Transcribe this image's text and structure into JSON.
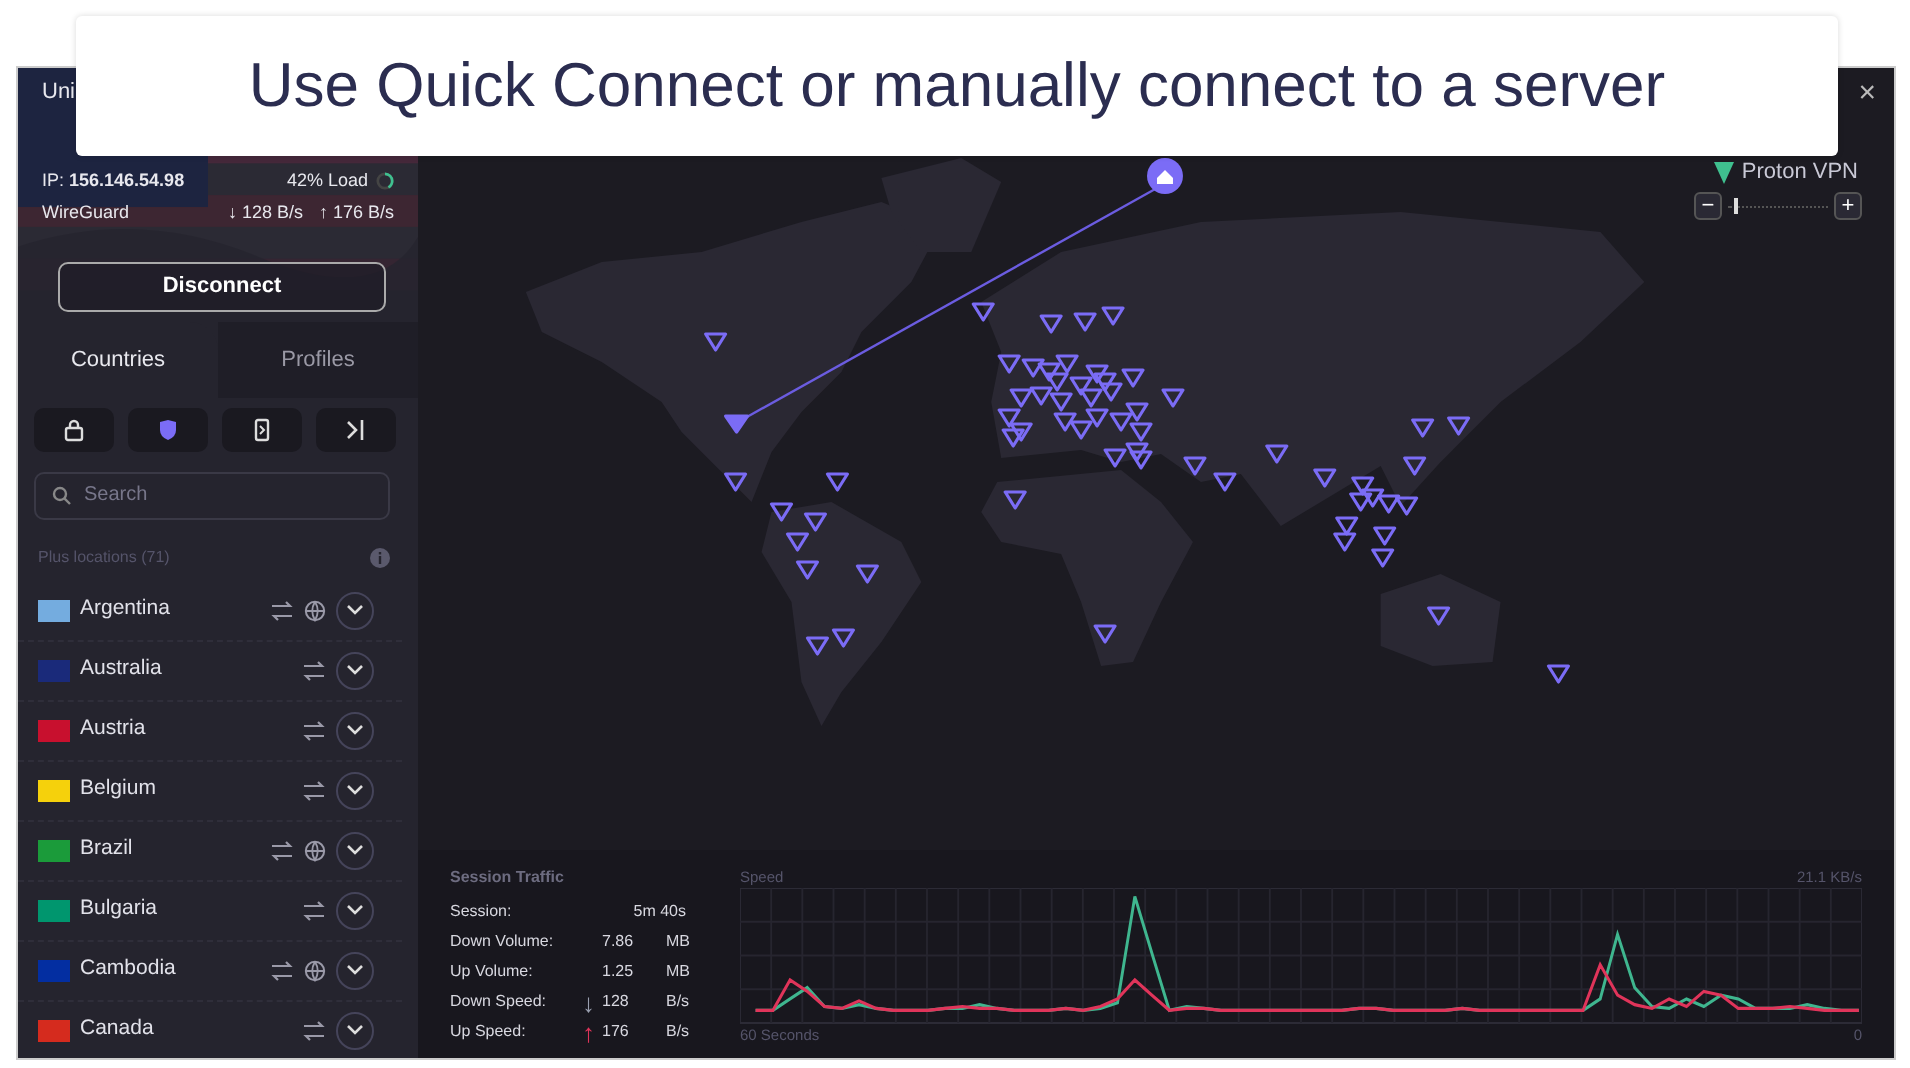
{
  "caption": "Use Quick Connect or manually connect to a server",
  "connection": {
    "country": "Uni",
    "ip": "IP: **156.146.54.98**",
    "load": "42% Load",
    "protocol": "WireGuard",
    "down": "↓ 128 B/s",
    "up": "↑ 176 B/s"
  },
  "disconnect_button": "Disconnect",
  "tabs": [
    {
      "label": "Countries",
      "selected": true
    },
    {
      "label": "Profiles",
      "selected": false
    }
  ],
  "filters": [
    {
      "kind": "lock"
    },
    {
      "kind": "shield"
    },
    {
      "kind": "phone"
    },
    {
      "kind": "arrow"
    }
  ],
  "search": {
    "placeholder": "Search"
  },
  "section_label": "Plus locations (71)",
  "countries": [
    {
      "name": "Argentina",
      "globe_icon": true,
      "color": "#74acdf"
    },
    {
      "name": "Australia",
      "globe_icon": false,
      "color": "#1a2a7a"
    },
    {
      "name": "Austria",
      "globe_icon": false,
      "color": "#c8102e"
    },
    {
      "name": "Belgium",
      "globe_icon": false,
      "color": "#f5d10c"
    },
    {
      "name": "Brazil",
      "globe_icon": true,
      "color": "#1b9b3a"
    },
    {
      "name": "Bulgaria",
      "globe_icon": false,
      "color": "#00966e"
    },
    {
      "name": "Cambodia",
      "globe_icon": true,
      "color": "#032ea1"
    },
    {
      "name": "Canada",
      "globe_icon": false,
      "color": "#d52b1e"
    }
  ],
  "brand": "Proton VPN",
  "map_zoom": {
    "out": "−",
    "in": "+",
    "level": 0.05
  },
  "close": "×",
  "traffic": {
    "title": "Session Traffic",
    "rows": [
      {
        "label": "Session:",
        "value": "5m 40s"
      },
      {
        "label": "Down Volume:",
        "value": "7.86",
        "unit": "MB"
      },
      {
        "label": "Up Volume:",
        "value": "1.25",
        "unit": "MB"
      },
      {
        "label": "Down Speed:",
        "arrow": "↓",
        "color": "#9aa0b0",
        "value": "128",
        "unit": "B/s"
      },
      {
        "label": "Up Speed:",
        "arrow": "↑",
        "color": "#e0345a",
        "value": "176",
        "unit": "B/s"
      }
    ],
    "graph_title": "Speed",
    "graph_max": "21.1  KB/s",
    "graph_start": "60 Seconds",
    "graph_end": "0"
  }
}
